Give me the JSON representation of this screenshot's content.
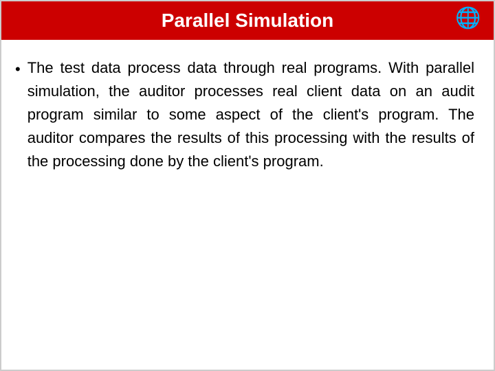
{
  "slide": {
    "title": "Parallel Simulation",
    "bullet": {
      "text": "The test data process data through real programs.  With parallel simulation, the auditor processes real client data on an audit program similar to some aspect of the client's program.  The auditor compares the results of this processing with the results of the processing done by the client's program."
    }
  },
  "icons": {
    "globe": "🌐"
  }
}
